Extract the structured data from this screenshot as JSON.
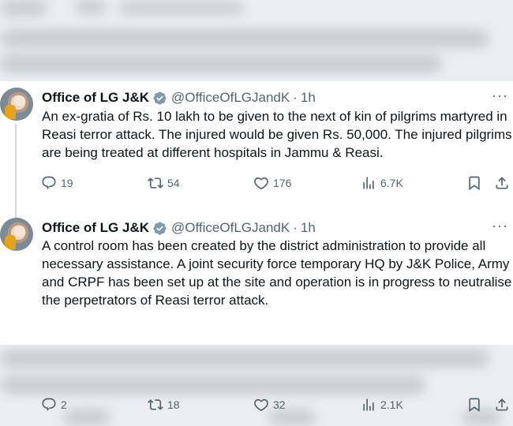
{
  "tweets": [
    {
      "author": {
        "name": "Office of LG J&K",
        "handle": "@OfficeOfLGJandK",
        "verified": true
      },
      "time": "1h",
      "separator": "·",
      "text": "An ex-gratia of Rs. 10 lakh to be given to the next of kin of pilgrims martyred in Reasi terror attack. The injured would be given Rs. 50,000. The injured pilgrims are being treated at different hospitals in Jammu & Reasi.",
      "stats": {
        "replies": "19",
        "reposts": "54",
        "likes": "176",
        "views": "6.7K"
      }
    },
    {
      "author": {
        "name": "Office of LG J&K",
        "handle": "@OfficeOfLGJandK",
        "verified": true
      },
      "time": "1h",
      "separator": "·",
      "text": "A control room has been created by the district administration to provide all necessary assistance. A joint security force temporary HQ by J&K Police, Army and CRPF has been set up at the site and operation is in progress to neutralise the perpetrators of Reasi terror attack.",
      "stats": {
        "replies": "2",
        "reposts": "18",
        "likes": "32",
        "views": "2.1K"
      }
    }
  ],
  "more_label": "···",
  "icons": {
    "verified": "verified-badge-icon",
    "reply": "reply-icon",
    "repost": "repost-icon",
    "like": "heart-icon",
    "views": "views-chart-icon",
    "bookmark": "bookmark-icon",
    "share": "share-icon"
  },
  "colors": {
    "text": "#0f1419",
    "secondary": "#536471",
    "verified": "#829aab",
    "thread_line": "#cfd9de"
  }
}
